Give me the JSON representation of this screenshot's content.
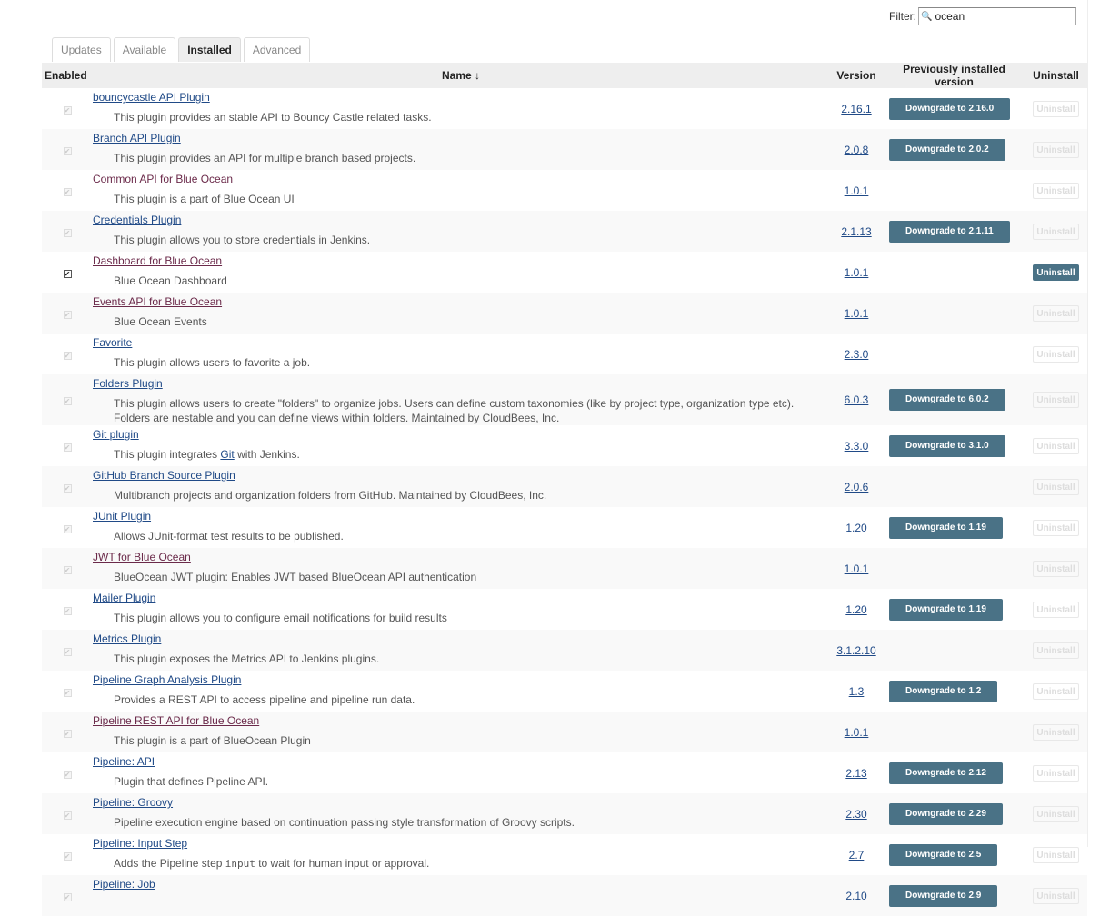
{
  "filter": {
    "label": "Filter:",
    "value": "ocean"
  },
  "tabs": [
    "Updates",
    "Available",
    "Installed",
    "Advanced"
  ],
  "active_tab": "Installed",
  "table": {
    "headers": {
      "enabled": "Enabled",
      "name": "Name ↓",
      "version": "Version",
      "previous": "Previously installed version",
      "uninstall": "Uninstall"
    },
    "uninstall_label": "Uninstall",
    "rows": [
      {
        "name": "bouncycastle API Plugin",
        "desc": "This plugin provides an stable API to Bouncy Castle related tasks.",
        "version": "2.16.1",
        "downgrade": "Downgrade to 2.16.0",
        "enabled": false,
        "can_uninstall": false
      },
      {
        "name": "Branch API Plugin",
        "desc": "This plugin provides an API for multiple branch based projects.",
        "version": "2.0.8",
        "downgrade": "Downgrade to 2.0.2",
        "enabled": false,
        "can_uninstall": false
      },
      {
        "name": "Common API for Blue Ocean",
        "desc": "This plugin is a part of Blue Ocean UI",
        "version": "1.0.1",
        "downgrade": "",
        "enabled": false,
        "can_uninstall": false,
        "visited": true
      },
      {
        "name": "Credentials Plugin",
        "desc": "This plugin allows you to store credentials in Jenkins.",
        "version": "2.1.13",
        "downgrade": "Downgrade to 2.1.11",
        "enabled": false,
        "can_uninstall": false
      },
      {
        "name": "Dashboard for Blue Ocean",
        "desc": "Blue Ocean Dashboard",
        "version": "1.0.1",
        "downgrade": "",
        "enabled": true,
        "can_uninstall": true,
        "visited": true
      },
      {
        "name": "Events API for Blue Ocean",
        "desc": "Blue Ocean Events",
        "version": "1.0.1",
        "downgrade": "",
        "enabled": false,
        "can_uninstall": false,
        "visited": true
      },
      {
        "name": "Favorite",
        "desc": "This plugin allows users to favorite a job.",
        "version": "2.3.0",
        "downgrade": "",
        "enabled": false,
        "can_uninstall": false
      },
      {
        "name": "Folders Plugin",
        "desc": "This plugin allows users to create \"folders\" to organize jobs. Users can define custom taxonomies (like by project type, organization type etc). Folders are nestable and you can define views within folders. Maintained by CloudBees, Inc.",
        "version": "6.0.3",
        "downgrade": "Downgrade to 6.0.2",
        "enabled": false,
        "can_uninstall": false,
        "tall": true
      },
      {
        "name": "Git plugin",
        "desc_pre": "This plugin integrates ",
        "desc_link": "Git",
        "desc_post": " with Jenkins.",
        "version": "3.3.0",
        "downgrade": "Downgrade to 3.1.0",
        "enabled": false,
        "can_uninstall": false
      },
      {
        "name": "GitHub Branch Source Plugin",
        "desc": "Multibranch projects and organization folders from GitHub. Maintained by CloudBees, Inc.",
        "version": "2.0.6",
        "downgrade": "",
        "enabled": false,
        "can_uninstall": false
      },
      {
        "name": "JUnit Plugin",
        "desc": "Allows JUnit-format test results to be published.",
        "version": "1.20",
        "downgrade": "Downgrade to 1.19",
        "enabled": false,
        "can_uninstall": false
      },
      {
        "name": "JWT for Blue Ocean",
        "desc": "BlueOcean JWT plugin: Enables JWT based BlueOcean API authentication",
        "version": "1.0.1",
        "downgrade": "",
        "enabled": false,
        "can_uninstall": false,
        "visited": true
      },
      {
        "name": "Mailer Plugin",
        "desc": "This plugin allows you to configure email notifications for build results",
        "version": "1.20",
        "downgrade": "Downgrade to 1.19",
        "enabled": false,
        "can_uninstall": false
      },
      {
        "name": "Metrics Plugin",
        "desc": "This plugin exposes the Metrics API to Jenkins plugins.",
        "version": "3.1.2.10",
        "downgrade": "",
        "enabled": false,
        "can_uninstall": false
      },
      {
        "name": "Pipeline Graph Analysis Plugin",
        "desc": "Provides a REST API to access pipeline and pipeline run data.",
        "version": "1.3",
        "downgrade": "Downgrade to 1.2",
        "enabled": false,
        "can_uninstall": false
      },
      {
        "name": "Pipeline REST API for Blue Ocean",
        "desc": "This plugin is a part of BlueOcean Plugin",
        "version": "1.0.1",
        "downgrade": "",
        "enabled": false,
        "can_uninstall": false,
        "visited": true
      },
      {
        "name": "Pipeline: API",
        "desc": "Plugin that defines Pipeline API.",
        "version": "2.13",
        "downgrade": "Downgrade to 2.12",
        "enabled": false,
        "can_uninstall": false
      },
      {
        "name": "Pipeline: Groovy",
        "desc": "Pipeline execution engine based on continuation passing style transformation of Groovy scripts.",
        "version": "2.30",
        "downgrade": "Downgrade to 2.29",
        "enabled": false,
        "can_uninstall": false
      },
      {
        "name": "Pipeline: Input Step",
        "desc_pre": "Adds the Pipeline step ",
        "desc_code": "input",
        "desc_post": " to wait for human input or approval.",
        "version": "2.7",
        "downgrade": "Downgrade to 2.5",
        "enabled": false,
        "can_uninstall": false
      },
      {
        "name": "Pipeline: Job",
        "desc": "",
        "version": "2.10",
        "downgrade": "Downgrade to 2.9",
        "enabled": false,
        "can_uninstall": false
      }
    ]
  }
}
